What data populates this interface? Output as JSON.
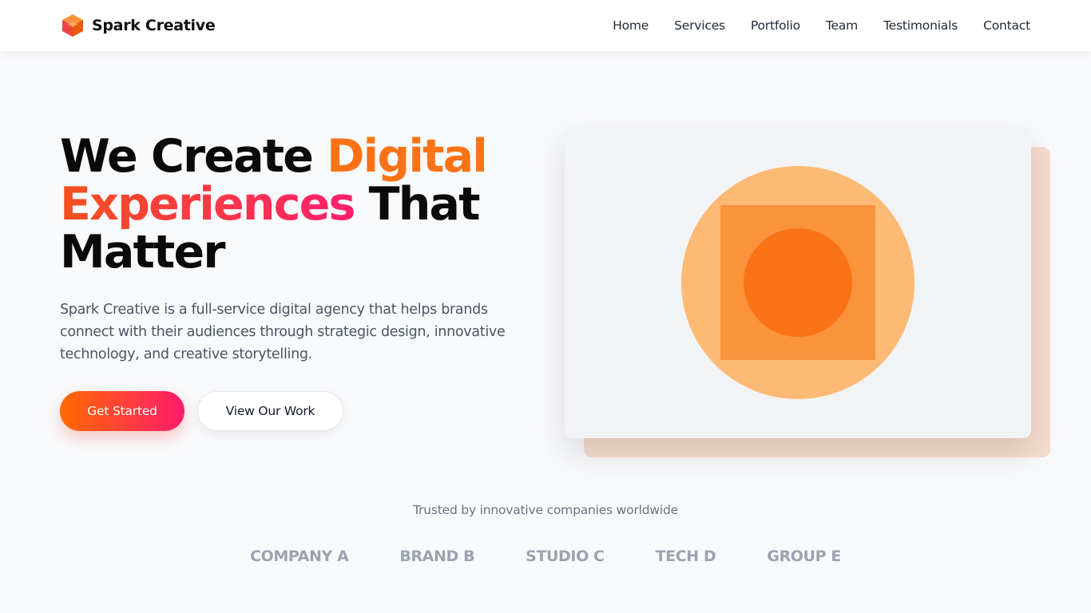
{
  "brand": {
    "name": "Spark Creative",
    "logo_icon": "cube-icon",
    "colors": {
      "logo_top": "#f97316",
      "logo_left": "#ef4444",
      "logo_right": "#ea580c"
    }
  },
  "nav": {
    "links": [
      "Home",
      "Services",
      "Portfolio",
      "Team",
      "Testimonials",
      "Contact"
    ]
  },
  "hero": {
    "title_part1": "We Create ",
    "title_highlight1": "Digital",
    "title_highlight2": "Experiences",
    "title_part2": " That Matter",
    "description": "Spark Creative is a full-service digital agency that helps brands connect with their audiences through strategic design, innovative technology, and creative storytelling.",
    "primary_cta": "Get Started",
    "secondary_cta": "View Our Work",
    "colors": {
      "accent_orange": "#f97316",
      "accent_pink": "#ff1f6e"
    }
  },
  "illustration": {
    "icon": "abstract-shapes-illustration",
    "colors": {
      "outer_circle": "#fdba74",
      "square": "#fb923c",
      "inner_circle": "#f97316",
      "card_back": "#f5dccd"
    }
  },
  "trusted": {
    "label": "Trusted by innovative companies worldwide",
    "companies": [
      "COMPANY A",
      "BRAND B",
      "STUDIO C",
      "TECH D",
      "GROUP E"
    ]
  }
}
